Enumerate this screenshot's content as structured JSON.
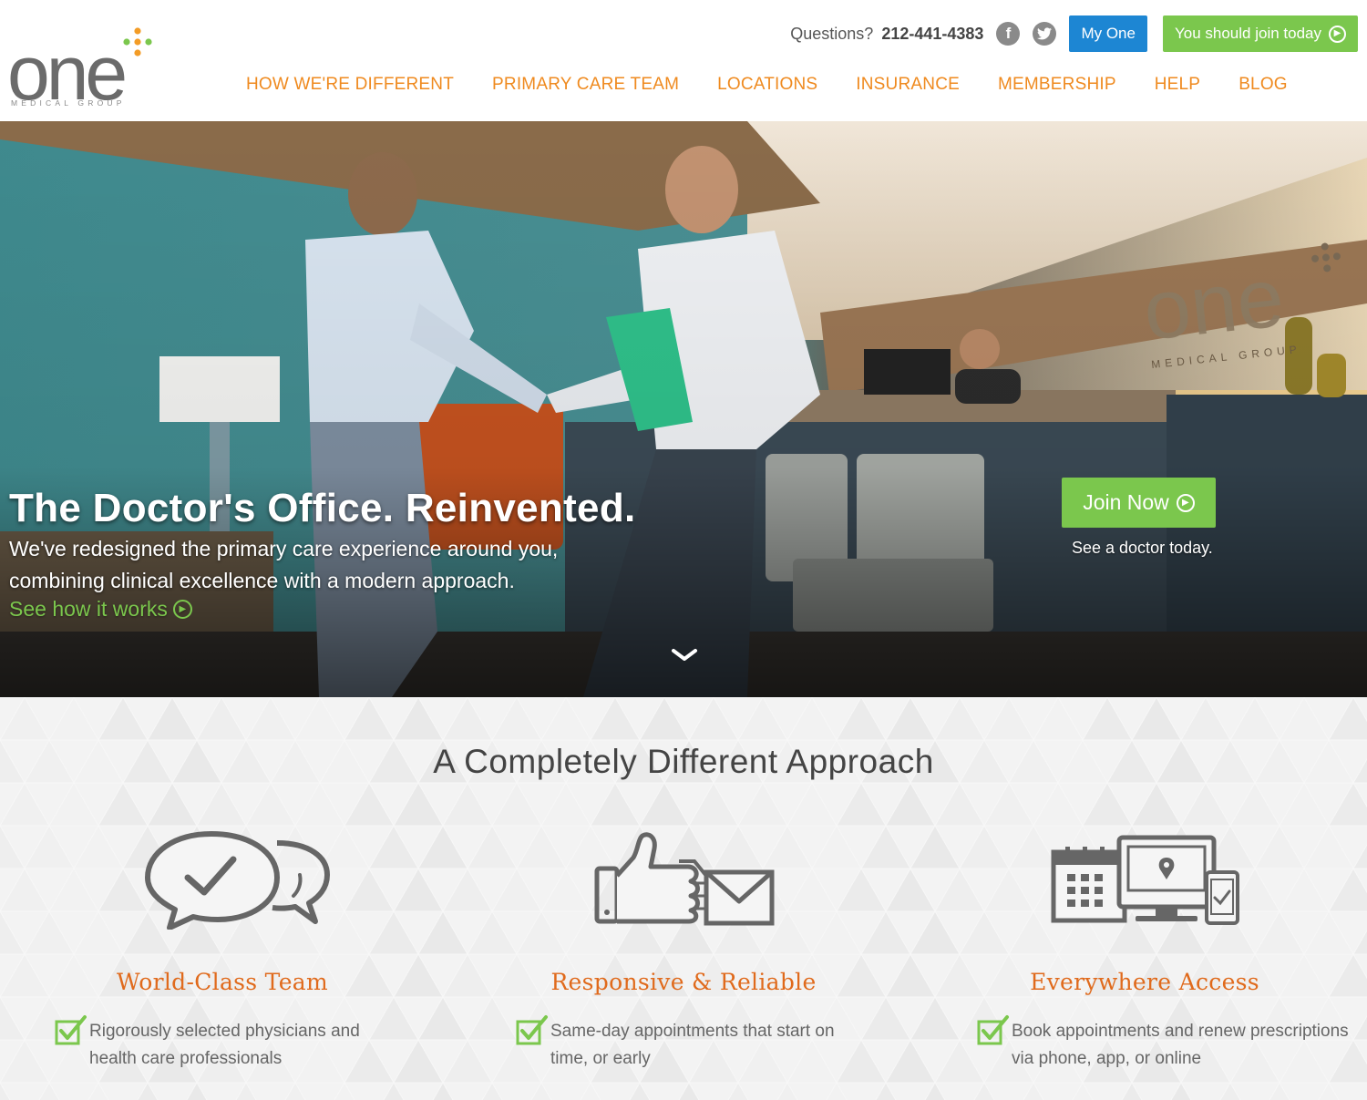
{
  "brand": {
    "logo_word": "one",
    "logo_sub": "MEDICAL GROUP",
    "dot_colors": [
      "#f39c26",
      "#7bc74d",
      "#f39c26",
      "#7bc74d",
      "#f39c26"
    ]
  },
  "utility": {
    "questions_label": "Questions?",
    "phone": "212-441-4383",
    "social": [
      {
        "name": "facebook-icon",
        "glyph": "f"
      },
      {
        "name": "twitter-icon",
        "glyph": "t"
      }
    ],
    "my_one_label": "My One",
    "join_label": "You should join today"
  },
  "nav": {
    "items": [
      {
        "label": "HOW WE'RE DIFFERENT"
      },
      {
        "label": "PRIMARY CARE TEAM"
      },
      {
        "label": "LOCATIONS"
      },
      {
        "label": "INSURANCE"
      },
      {
        "label": "MEMBERSHIP"
      },
      {
        "label": "HELP"
      },
      {
        "label": "BLOG"
      }
    ]
  },
  "hero": {
    "title": "The Doctor's Office. Reinvented.",
    "description": "We've redesigned the primary care experience around you, combining clinical excellence with a modern approach.",
    "link_label": "See how it works",
    "join_button": "Join Now",
    "join_subtext": "See a doctor today.",
    "sign_word": "one",
    "sign_sub": "MEDICAL GROUP"
  },
  "features": {
    "title": "A Completely Different Approach",
    "items": [
      {
        "title": "World-Class Team",
        "icon": "speech-bubbles-check-icon",
        "bullet": "Rigorously selected physicians and health care professionals"
      },
      {
        "title": "Responsive & Reliable",
        "icon": "thumbs-up-envelope-icon",
        "bullet": "Same-day appointments that start on time, or early"
      },
      {
        "title": "Everywhere Access",
        "icon": "calendar-devices-icon",
        "bullet": "Book appointments and renew prescriptions via phone, app, or online"
      }
    ]
  },
  "colors": {
    "accent_orange": "#ef8a1f",
    "heading_orange": "#e06a1c",
    "green": "#7bc74d",
    "blue": "#1d86d3"
  }
}
